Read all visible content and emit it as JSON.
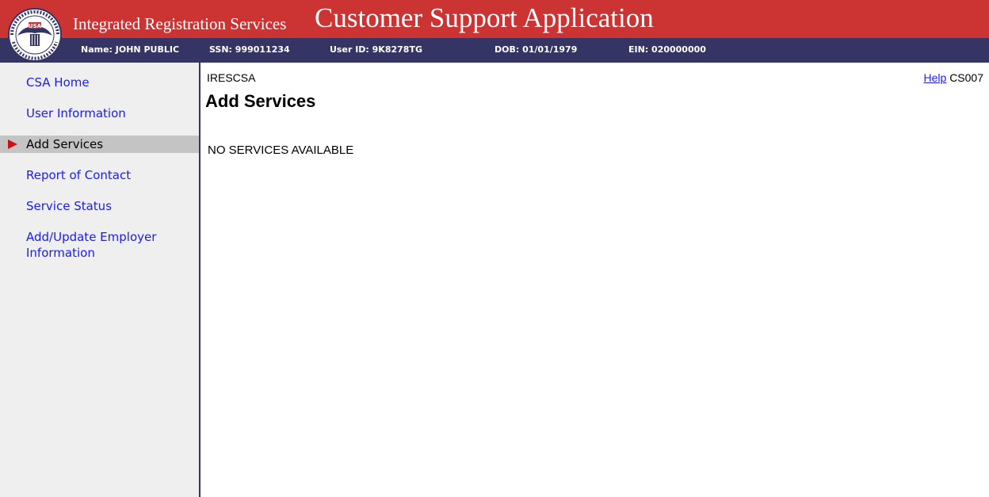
{
  "header": {
    "subtitle": "Integrated Registration Services",
    "title": "Customer Support Application",
    "seal_text": "USA",
    "seal_ring_text": "SOCIAL SECURITY ADMINISTRATION"
  },
  "infobar": {
    "name": "Name: JOHN PUBLIC",
    "ssn": "SSN: 999011234",
    "user_id": "User ID: 9K8278TG",
    "dob": "DOB: 01/01/1979",
    "ein": "EIN: 020000000"
  },
  "sidebar": {
    "items": [
      {
        "label": "CSA Home"
      },
      {
        "label": "User Information"
      },
      {
        "label": "Add Services"
      },
      {
        "label": "Report of Contact"
      },
      {
        "label": "Service Status"
      },
      {
        "label": "Add/Update Employer Information"
      }
    ],
    "active_index": 2
  },
  "main": {
    "screen_id": "IRESCSA",
    "title": "Add Services",
    "message": "NO SERVICES AVAILABLE",
    "help_label": "Help",
    "screen_code": "CS007"
  },
  "colors": {
    "banner": "#cc3333",
    "infobar": "#343465",
    "link": "#1a1aff",
    "arrow": "#cc1111"
  }
}
